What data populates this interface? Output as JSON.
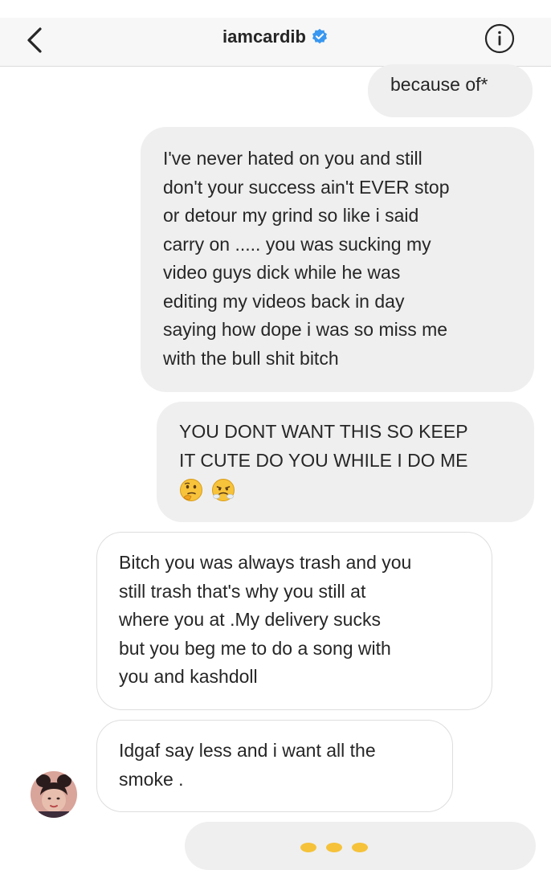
{
  "header": {
    "username": "iamcardib",
    "back_icon": "chevron-left-icon",
    "verified_icon": "verified-badge-icon",
    "info_icon": "info-icon"
  },
  "messages": [
    {
      "direction": "sent",
      "lines": [
        "because of*"
      ]
    },
    {
      "direction": "sent",
      "lines": [
        "I've never hated on you and still",
        "don't your success ain't EVER stop",
        "or detour my grind so like i said",
        "carry on ..... you was sucking my",
        "video guys dick while he was",
        "editing my videos back in day",
        "saying how dope i was so miss me",
        "with the bull shit bitch"
      ]
    },
    {
      "direction": "sent",
      "lines": [
        "YOU DONT WANT THIS SO KEEP",
        "IT CUTE DO YOU WHILE I DO ME"
      ],
      "emojis": [
        "thinking-face-emoji",
        "face-with-steam-emoji"
      ]
    },
    {
      "direction": "received",
      "lines": [
        "Bitch you was always trash and you",
        "still trash that's why you still at",
        "where you at .My delivery sucks",
        "but you beg me to do a song with",
        "you and kashdoll"
      ]
    },
    {
      "direction": "received",
      "lines": [
        "Idgaf say less and i want all the",
        "smoke ."
      ]
    }
  ],
  "colors": {
    "sent_bubble": "#efefef",
    "received_border": "#dedede",
    "verified_blue": "#3897f0",
    "header_bg": "#f7f7f7"
  }
}
